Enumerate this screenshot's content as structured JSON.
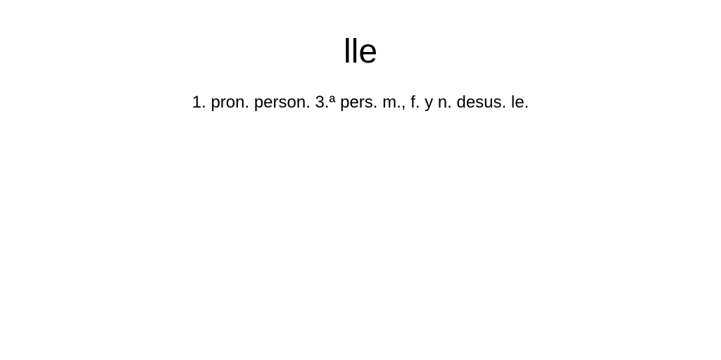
{
  "entry": {
    "headword": "lle",
    "definitions": [
      {
        "text": "1. pron. person. 3.ª pers. m., f. y n. desus. le."
      }
    ]
  }
}
